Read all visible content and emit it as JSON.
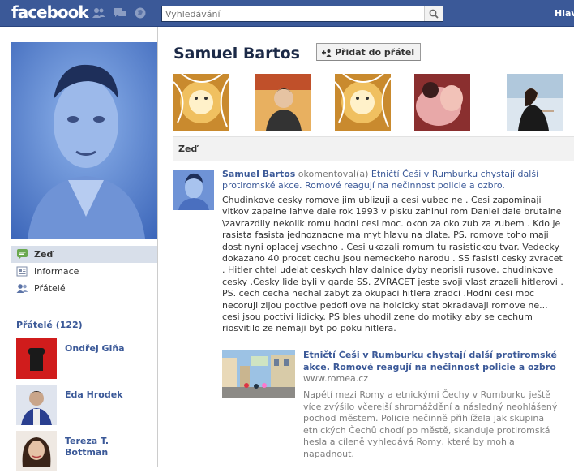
{
  "topbar": {
    "logo": "facebook",
    "search_placeholder": "Vyhledávání",
    "home_label": "Hlavní"
  },
  "colors": {
    "brand": "#3b5998",
    "link": "#3b5998",
    "nav_active": "#d8dfea"
  },
  "left": {
    "nav": [
      {
        "label": "Zeď",
        "icon": "wall-icon"
      },
      {
        "label": "Informace",
        "icon": "info-icon"
      },
      {
        "label": "Přátelé",
        "icon": "friends-icon"
      }
    ],
    "friends_heading": "Přátelé (122)",
    "friends": [
      {
        "name": "Ondřej Giňa"
      },
      {
        "name": "Eda Hrodek"
      },
      {
        "name": "Tereza T. Bottman"
      }
    ]
  },
  "profile": {
    "name": "Samuel Bartos",
    "add_friend_label": "Přidat do přátel"
  },
  "wall": {
    "tab_label": "Zeď",
    "story": {
      "author": "Samuel Bartos",
      "verb": "okomentoval(a)",
      "link_text": "Etničtí Češi v Rumburku chystají další protiromské akce. Romové reagují na nečinnost policie a ozbro.",
      "body": "Chudinkove cesky romove jim ublizuji a cesi vubec ne . Cesi zapominaji vitkov zapalne lahve dale rok 1993 v pisku zahinul rom Daniel dale brutalne \\zavrazdily nekolik romu hodni cesi moc. okon za oko zub za zubem . Kdo je rasista fasista jednoznacne ma myt hlavu na dlate. PS. romove toho maji dost nyni oplacej vsechno . Cesi ukazali romum tu rasistickou tvar. Vedecky dokazano 40 procet cechu jsou nemeckeho narodu . SS fasisti cesky zvracet . Hitler chtel udelat ceskych hlav dalnice dyby neprisli rusove. chudinkove cesky .Cesky lide byli v garde SS. ZVRACET jeste svoji vlast zrazeli hitlerovi . PS. cech cecha nechal zabyt za okupaci hitlera zradci .Hodni cesi moc necoruji zijou poctive pedofilove na holcicky stat okradavaji romove ne... cesi jsou poctivi lidicky. PS bles uhodil zene do motiky aby se cechum riosvitilo ze nemaji byt po poku hitlera."
    },
    "attachment": {
      "title": "Etničtí Češi v Rumburku chystají další protiromské akce. Romové reagují na nečinnost policie a ozbro",
      "source": "www.romea.cz",
      "description": "Napětí mezi Romy a etnickými Čechy v Rumburku ještě více zvýšilo včerejší shromáždění a následný neohlášený pochod městem. Policie nečinně přihlížela jak skupina etnických Čechů chodí po městě, skanduje protiromská hesla a cíleně vyhledává Romy, které by mohla napadnout."
    }
  }
}
